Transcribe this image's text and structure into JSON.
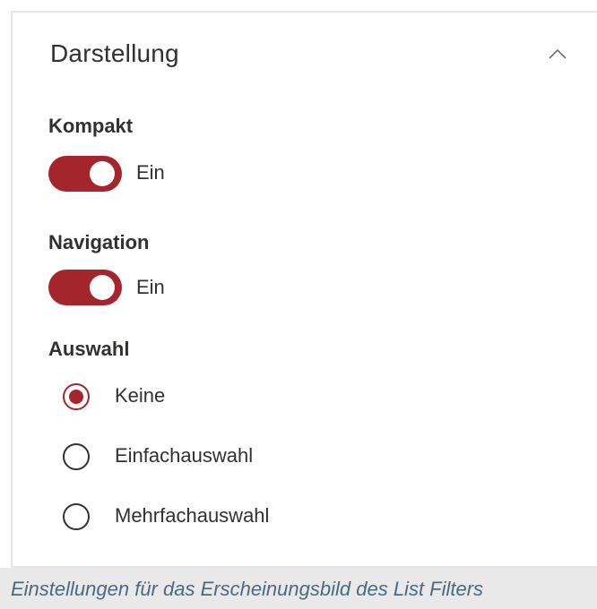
{
  "panel": {
    "title": "Darstellung",
    "collapse_icon": "chevron-up-icon",
    "groups": {
      "compact": {
        "label": "Kompakt",
        "state": "Ein",
        "on": true
      },
      "navigation": {
        "label": "Navigation",
        "state": "Ein",
        "on": true
      }
    },
    "selection": {
      "label": "Auswahl",
      "options": [
        {
          "label": "Keine",
          "checked": true
        },
        {
          "label": "Einfachauswahl",
          "checked": false
        },
        {
          "label": "Mehrfachauswahl",
          "checked": false
        }
      ]
    }
  },
  "caption": "Einstellungen für das Erscheinungsbild des List Filters",
  "colors": {
    "accent": "#a4262c",
    "text": "#323130",
    "caption_text": "#4a6a80",
    "caption_bg": "#e9e9e9"
  }
}
